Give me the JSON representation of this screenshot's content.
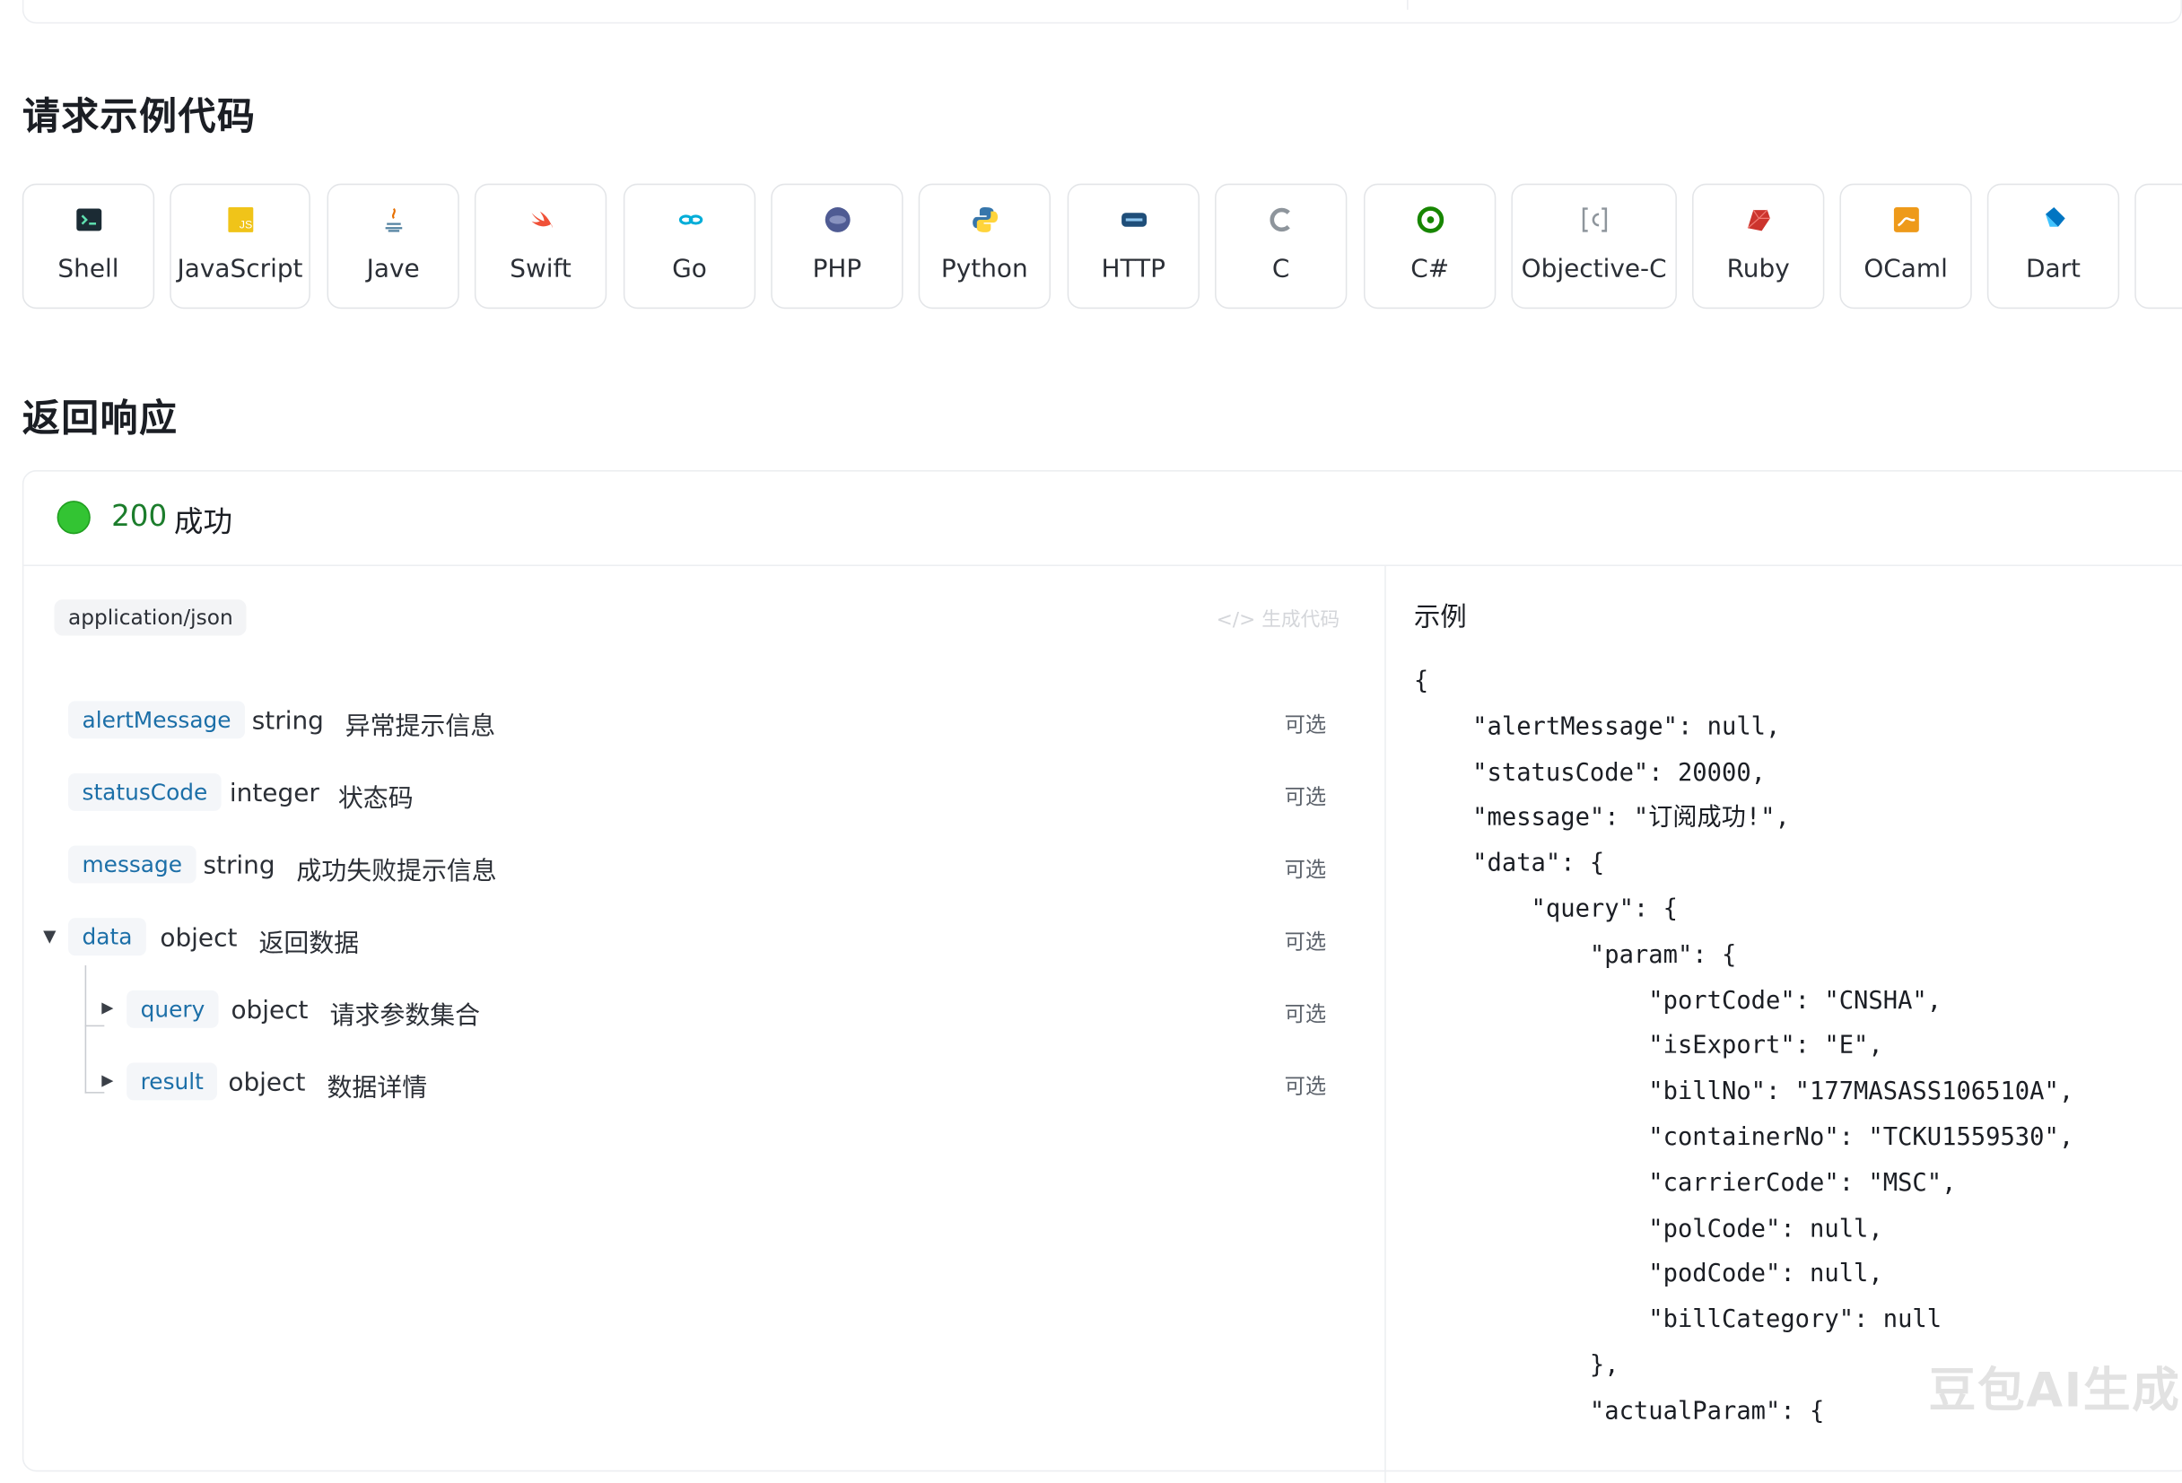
{
  "sections": {
    "request_example_title": "请求示例代码",
    "response_title": "返回响应"
  },
  "languages": [
    {
      "label": "Shell",
      "icon": "terminal-icon",
      "color": "#1b2b34"
    },
    {
      "label": "JavaScript",
      "icon": "js-icon",
      "color": "#f0c419"
    },
    {
      "label": "Jave",
      "icon": "java-icon",
      "color": "#5382a1"
    },
    {
      "label": "Swift",
      "icon": "swift-icon",
      "color": "#f05138"
    },
    {
      "label": "Go",
      "icon": "go-icon",
      "color": "#00add8"
    },
    {
      "label": "PHP",
      "icon": "php-icon",
      "color": "#4f5b93"
    },
    {
      "label": "Python",
      "icon": "python-icon",
      "color": "#3776ab"
    },
    {
      "label": "HTTP",
      "icon": "http-icon",
      "color": "#1f4e79"
    },
    {
      "label": "C",
      "icon": "c-icon",
      "color": "#8e959c"
    },
    {
      "label": "C#",
      "icon": "csharp-icon",
      "color": "#178600"
    },
    {
      "label": "Objective-C",
      "icon": "objc-icon",
      "color": "#8e959c"
    },
    {
      "label": "Ruby",
      "icon": "ruby-icon",
      "color": "#cc342d"
    },
    {
      "label": "OCaml",
      "icon": "ocaml-icon",
      "color": "#ee9a1a"
    },
    {
      "label": "Dart",
      "icon": "dart-icon",
      "color": "#0175c2"
    }
  ],
  "response": {
    "status_code": "200",
    "status_text": "成功",
    "status_color": "#33c433",
    "content_type": "application/json",
    "generate_code": "生成代码",
    "fields": [
      {
        "name": "alertMessage",
        "type": "string",
        "desc": "异常提示信息",
        "optional": "可选"
      },
      {
        "name": "statusCode",
        "type": "integer",
        "desc": "状态码",
        "optional": "可选"
      },
      {
        "name": "message",
        "type": "string",
        "desc": "成功失败提示信息",
        "optional": "可选"
      },
      {
        "name": "data",
        "type": "object",
        "desc": "返回数据",
        "optional": "可选"
      },
      {
        "name": "query",
        "type": "object",
        "desc": "请求参数集合",
        "optional": "可选"
      },
      {
        "name": "result",
        "type": "object",
        "desc": "数据详情",
        "optional": "可选"
      }
    ],
    "example_title": "示例",
    "example_code": "{\n    \"alertMessage\": null,\n    \"statusCode\": 20000,\n    \"message\": \"订阅成功!\",\n    \"data\": {\n        \"query\": {\n            \"param\": {\n                \"portCode\": \"CNSHA\",\n                \"isExport\": \"E\",\n                \"billNo\": \"177MASASS106510A\",\n                \"containerNo\": \"TCKU1559530\",\n                \"carrierCode\": \"MSC\",\n                \"polCode\": null,\n                \"podCode\": null,\n                \"billCategory\": null\n            },\n            \"actualParam\": {"
  },
  "watermark": "豆包AI生成"
}
